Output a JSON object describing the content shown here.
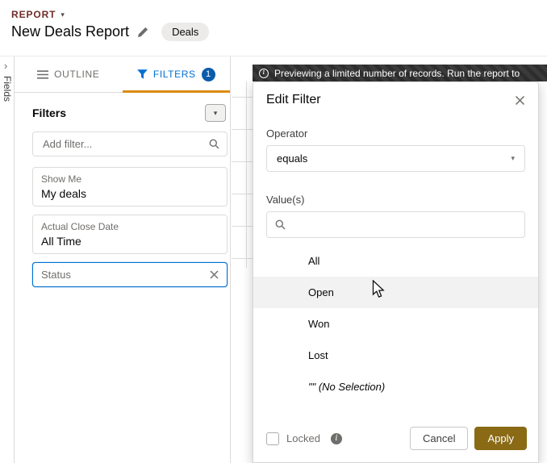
{
  "header": {
    "report_label": "REPORT",
    "title": "New Deals Report",
    "object_badge": "Deals"
  },
  "left_rail": {
    "label": "Fields"
  },
  "tabs": {
    "outline_label": "OUTLINE",
    "filters_label": "FILTERS",
    "filters_count": "1"
  },
  "filters_panel": {
    "heading": "Filters",
    "add_filter_placeholder": "Add filter...",
    "cards": [
      {
        "label": "Show Me",
        "value": "My deals"
      },
      {
        "label": "Actual Close Date",
        "value": "All Time"
      },
      {
        "label": "Status",
        "value": ""
      }
    ]
  },
  "banner": {
    "text": "Previewing a limited number of records. Run the report to"
  },
  "edit_filter": {
    "title": "Edit Filter",
    "operator_label": "Operator",
    "operator_value": "equals",
    "values_label": "Value(s)",
    "options": [
      "All",
      "Open",
      "Won",
      "Lost",
      "\"\" (No Selection)"
    ],
    "hovered_option": "Open",
    "locked_label": "Locked",
    "cancel_label": "Cancel",
    "apply_label": "Apply"
  },
  "colors": {
    "accent_blue": "#0070d2",
    "tab_active_underline": "#dd8c12",
    "selected_filter_border": "#0070d2",
    "apply_button": "#8a6a15",
    "banner_background": "#333333",
    "report_label": "#702c27"
  }
}
